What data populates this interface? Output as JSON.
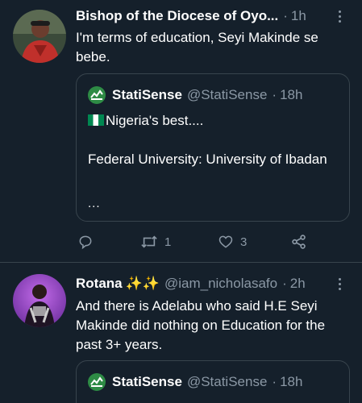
{
  "tweets": [
    {
      "author_name": "Bishop of the Diocese of Oyo...",
      "time": "1h",
      "text": "I'm terms of education, Seyi Makinde se bebe.",
      "quote": {
        "name": "StatiSense",
        "handle": "@StatiSense",
        "time": "18h",
        "flag_icon": "nigeria-flag-icon",
        "text_line1": "Nigeria's best....",
        "text_rest": "Federal University: University of Ibadan",
        "more": "..."
      },
      "replies": "",
      "retweets": "1",
      "likes": "3"
    },
    {
      "author_name": "Rotana",
      "emoji": "✨✨",
      "handle": "@iam_nicholasafo",
      "time": "2h",
      "text": "And there is Adelabu who said H.E Seyi Makinde did nothing on Education for the past 3+ years.",
      "quote": {
        "name": "StatiSense",
        "handle": "@StatiSense",
        "time": "18h"
      }
    }
  ],
  "colors": {
    "background": "#15202b",
    "divider": "#38444d",
    "secondary_text": "#8b98a5",
    "primary_text": "#ffffff"
  }
}
